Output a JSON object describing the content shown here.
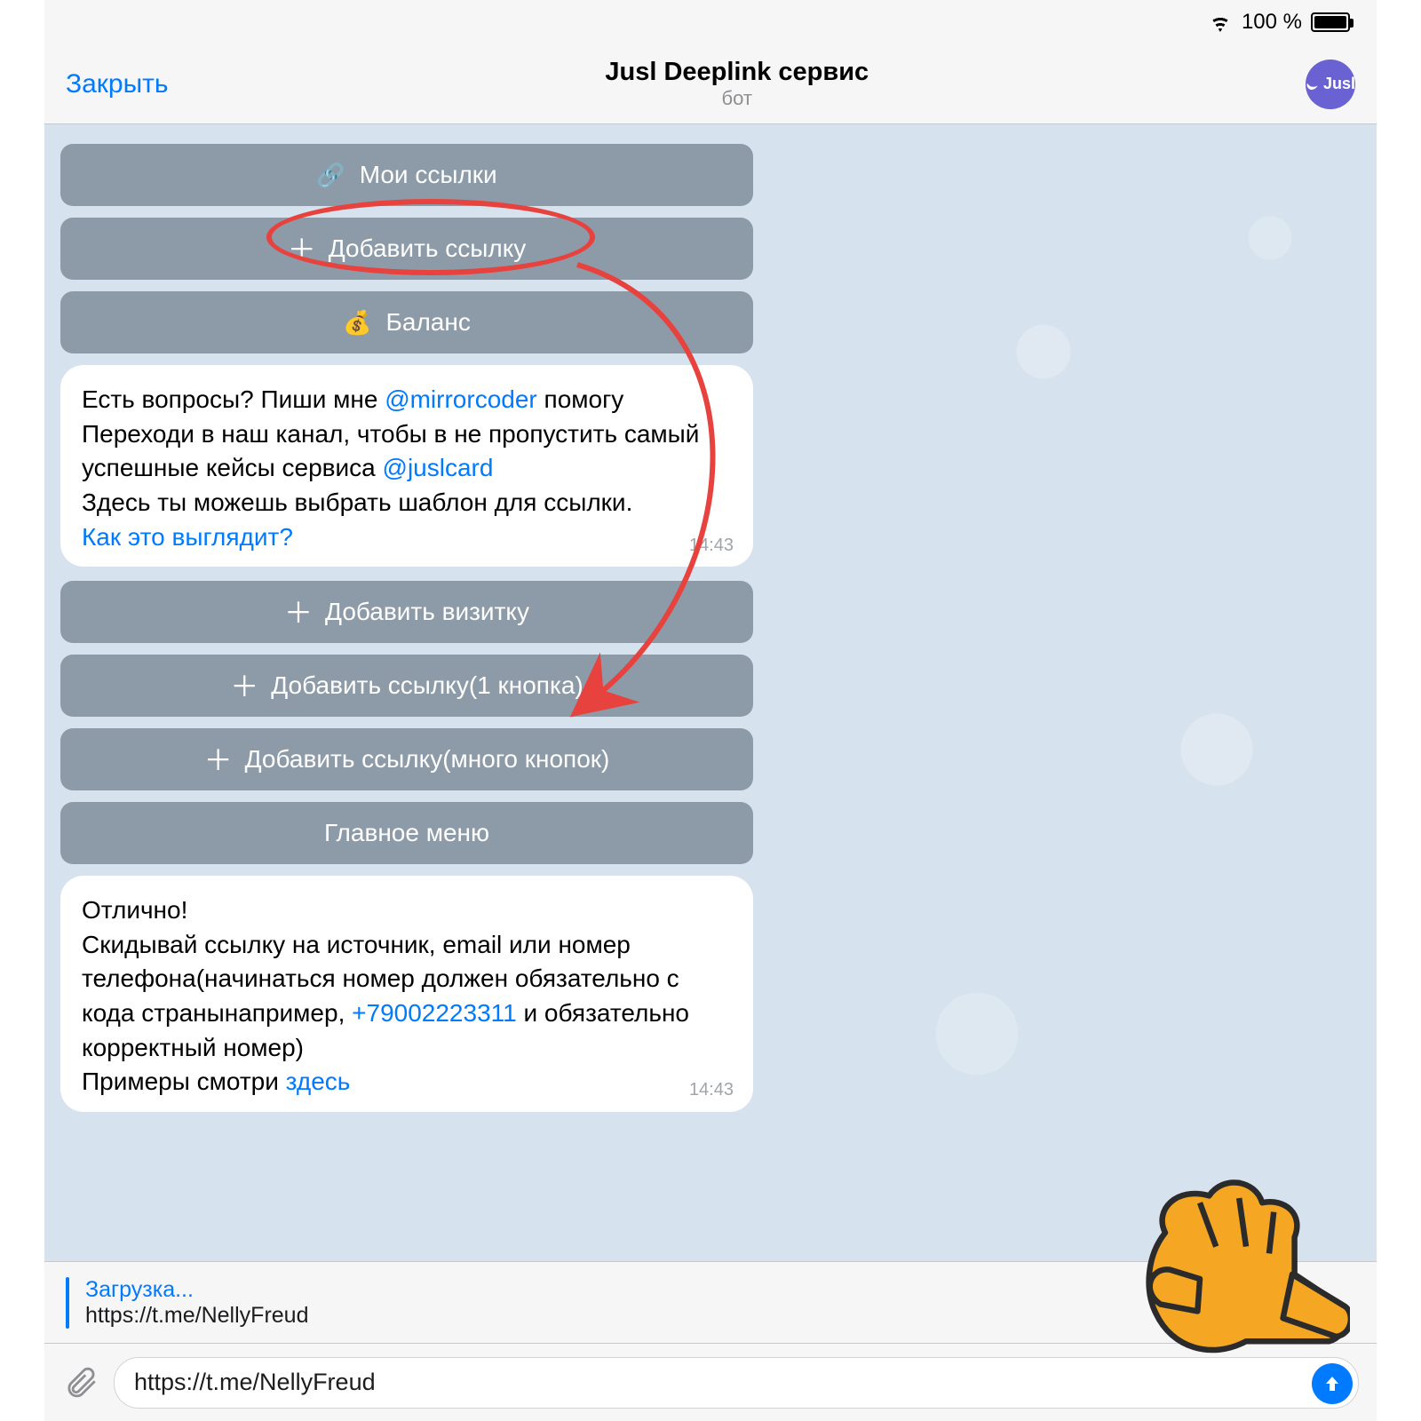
{
  "status": {
    "battery": "100 %"
  },
  "header": {
    "close": "Закрыть",
    "title": "Jusl Deeplink сервис",
    "subtitle": "бот",
    "avatar_label": "Jusl"
  },
  "kb1": {
    "links": "Мои ссылки",
    "add": "Добавить ссылку",
    "balance": "Баланс"
  },
  "msg1": {
    "line1a": "Есть вопросы? Пиши мне ",
    "mention1": "@mirrorcoder",
    "line1b": " помогу",
    "line2": "Переходи в наш канал, чтобы в не пропустить самый успешные кейсы сервиса ",
    "mention2": "@juslcard",
    "line3": "Здесь ты можешь выбрать шаблон для ссылки.",
    "link": "Как это выглядит?",
    "time": "14:43"
  },
  "kb2": {
    "b1": "Добавить визитку",
    "b2": "Добавить ссылку(1 кнопка)",
    "b3": "Добавить ссылку(много кнопок)",
    "b4": "Главное меню"
  },
  "msg2": {
    "line1": "Отлично!",
    "line2a": "Скидывай ссылку на источник, email или номер телефона(начинаться номер должен обязательно с кода странынапример, ",
    "phone": "+79002223311",
    "line2b": " и обязательно корректный номер)",
    "line3a": "Примеры смотри ",
    "link": "здесь",
    "time": "14:43"
  },
  "reply": {
    "title": "Загрузка...",
    "sub": "https://t.me/NellyFreud"
  },
  "input": {
    "value": "https://t.me/NellyFreud"
  }
}
